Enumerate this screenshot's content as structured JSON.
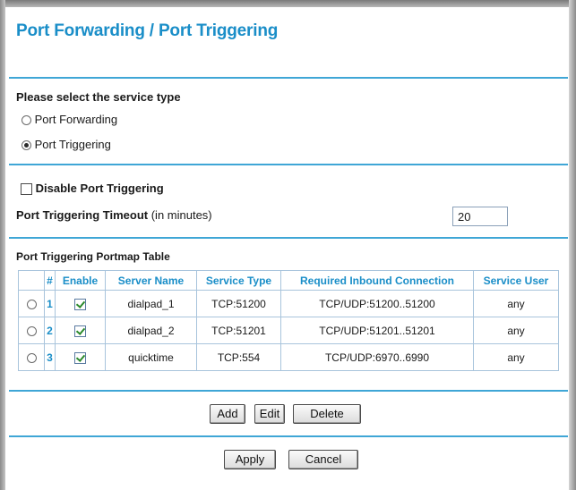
{
  "page": {
    "title": "Port Forwarding / Port Triggering"
  },
  "service_type": {
    "heading": "Please select the service type",
    "options": [
      {
        "label": "Port Forwarding",
        "selected": false
      },
      {
        "label": "Port Triggering",
        "selected": true
      }
    ]
  },
  "trigger_settings": {
    "disable_label": "Disable Port Triggering",
    "disable_checked": false,
    "timeout_label_bold": "Port Triggering Timeout",
    "timeout_label_suffix": " (in minutes)",
    "timeout_value": "20"
  },
  "portmap_table": {
    "heading": "Port Triggering Portmap Table",
    "columns": [
      "",
      "#",
      "Enable",
      "Server Name",
      "Service Type",
      "Required Inbound Connection",
      "Service User"
    ],
    "rows": [
      {
        "num": "1",
        "enabled": true,
        "server_name": "dialpad_1",
        "service_type": "TCP:51200",
        "inbound": "TCP/UDP:51200..51200",
        "user": "any"
      },
      {
        "num": "2",
        "enabled": true,
        "server_name": "dialpad_2",
        "service_type": "TCP:51201",
        "inbound": "TCP/UDP:51201..51201",
        "user": "any"
      },
      {
        "num": "3",
        "enabled": true,
        "server_name": "quicktime",
        "service_type": "TCP:554",
        "inbound": "TCP/UDP:6970..6990",
        "user": "any"
      }
    ]
  },
  "table_actions": {
    "add": "Add",
    "edit": "Edit",
    "delete": "Delete"
  },
  "form_actions": {
    "apply": "Apply",
    "cancel": "Cancel"
  },
  "colors": {
    "accent": "#1a8ec8",
    "rule": "#3fa6d6"
  }
}
